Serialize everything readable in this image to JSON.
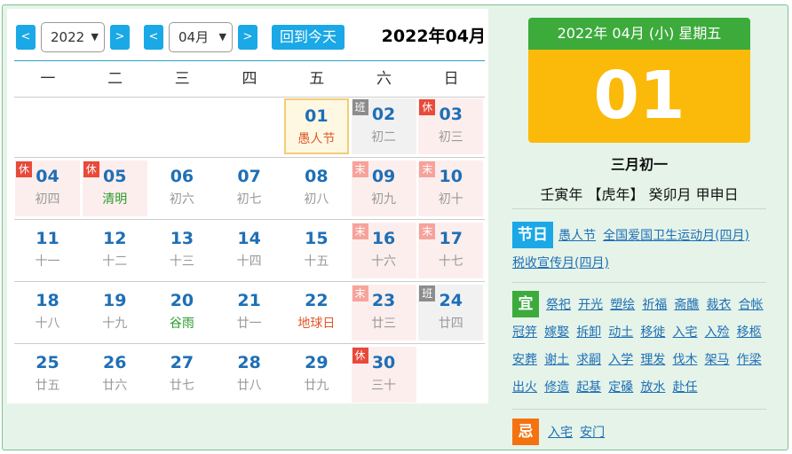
{
  "toolbar": {
    "prev_year": "<",
    "year_value": "2022",
    "next_year": ">",
    "prev_month": "<",
    "month_value": "04月",
    "next_month": ">",
    "today_label": "回到今天",
    "month_title": "2022年04月"
  },
  "weekdays": [
    "一",
    "二",
    "三",
    "四",
    "五",
    "六",
    "日"
  ],
  "weeks": [
    [
      null,
      null,
      null,
      null,
      {
        "day": "01",
        "lunar": "愚人节",
        "style": "red",
        "state": "selected",
        "badge": ""
      },
      {
        "day": "02",
        "lunar": "初二",
        "style": "",
        "state": "work",
        "badge": "班"
      },
      {
        "day": "03",
        "lunar": "初三",
        "style": "",
        "state": "rest",
        "badge": "休"
      }
    ],
    [
      {
        "day": "04",
        "lunar": "初四",
        "style": "",
        "state": "rest",
        "badge": "休"
      },
      {
        "day": "05",
        "lunar": "清明",
        "style": "fest",
        "state": "rest",
        "badge": "休"
      },
      {
        "day": "06",
        "lunar": "初六",
        "style": "",
        "state": "",
        "badge": ""
      },
      {
        "day": "07",
        "lunar": "初七",
        "style": "",
        "state": "",
        "badge": ""
      },
      {
        "day": "08",
        "lunar": "初八",
        "style": "",
        "state": "",
        "badge": ""
      },
      {
        "day": "09",
        "lunar": "初九",
        "style": "",
        "state": "rest",
        "badge": "末"
      },
      {
        "day": "10",
        "lunar": "初十",
        "style": "",
        "state": "rest",
        "badge": "末"
      }
    ],
    [
      {
        "day": "11",
        "lunar": "十一",
        "style": "",
        "state": "",
        "badge": ""
      },
      {
        "day": "12",
        "lunar": "十二",
        "style": "",
        "state": "",
        "badge": ""
      },
      {
        "day": "13",
        "lunar": "十三",
        "style": "",
        "state": "",
        "badge": ""
      },
      {
        "day": "14",
        "lunar": "十四",
        "style": "",
        "state": "",
        "badge": ""
      },
      {
        "day": "15",
        "lunar": "十五",
        "style": "",
        "state": "",
        "badge": ""
      },
      {
        "day": "16",
        "lunar": "十六",
        "style": "",
        "state": "rest",
        "badge": "末"
      },
      {
        "day": "17",
        "lunar": "十七",
        "style": "",
        "state": "rest",
        "badge": "末"
      }
    ],
    [
      {
        "day": "18",
        "lunar": "十八",
        "style": "",
        "state": "",
        "badge": ""
      },
      {
        "day": "19",
        "lunar": "十九",
        "style": "",
        "state": "",
        "badge": ""
      },
      {
        "day": "20",
        "lunar": "谷雨",
        "style": "fest",
        "state": "",
        "badge": ""
      },
      {
        "day": "21",
        "lunar": "廿一",
        "style": "",
        "state": "",
        "badge": ""
      },
      {
        "day": "22",
        "lunar": "地球日",
        "style": "red",
        "state": "",
        "badge": ""
      },
      {
        "day": "23",
        "lunar": "廿三",
        "style": "",
        "state": "rest",
        "badge": "末"
      },
      {
        "day": "24",
        "lunar": "廿四",
        "style": "",
        "state": "work",
        "badge": "班"
      }
    ],
    [
      {
        "day": "25",
        "lunar": "廿五",
        "style": "",
        "state": "",
        "badge": ""
      },
      {
        "day": "26",
        "lunar": "廿六",
        "style": "",
        "state": "",
        "badge": ""
      },
      {
        "day": "27",
        "lunar": "廿七",
        "style": "",
        "state": "",
        "badge": ""
      },
      {
        "day": "28",
        "lunar": "廿八",
        "style": "",
        "state": "",
        "badge": ""
      },
      {
        "day": "29",
        "lunar": "廿九",
        "style": "",
        "state": "",
        "badge": ""
      },
      {
        "day": "30",
        "lunar": "三十",
        "style": "",
        "state": "rest",
        "badge": "休"
      },
      null
    ]
  ],
  "detail": {
    "header": "2022年 04月 (小) 星期五",
    "day": "01",
    "lunar_date": "三月初一",
    "ganzhi": "壬寅年 【虎年】 癸卯月 甲申日",
    "holiday_label": "节日",
    "holidays": [
      "愚人节",
      "全国爱国卫生运动月(四月)",
      "税收宣传月(四月)"
    ],
    "yi_label": "宜",
    "yi": [
      "祭祀",
      "开光",
      "塑绘",
      "祈福",
      "斋醮",
      "裁衣",
      "合帐",
      "冠笄",
      "嫁娶",
      "拆卸",
      "动土",
      "移徙",
      "入宅",
      "入殓",
      "移柩",
      "安葬",
      "谢土",
      "求嗣",
      "入学",
      "理发",
      "伐木",
      "架马",
      "作梁",
      "出火",
      "修造",
      "起基",
      "定磉",
      "放水",
      "赴任"
    ],
    "ji_label": "忌",
    "ji": [
      "入宅",
      "安门"
    ]
  },
  "colors": {
    "accent_blue": "#1aa8e6",
    "green": "#3cab3c",
    "yellow": "#fbba09",
    "orange": "#f5730f",
    "rest_badge": "#e84a3a",
    "weekend_badge": "#f6a39c",
    "work_badge": "#8c8c8c"
  }
}
